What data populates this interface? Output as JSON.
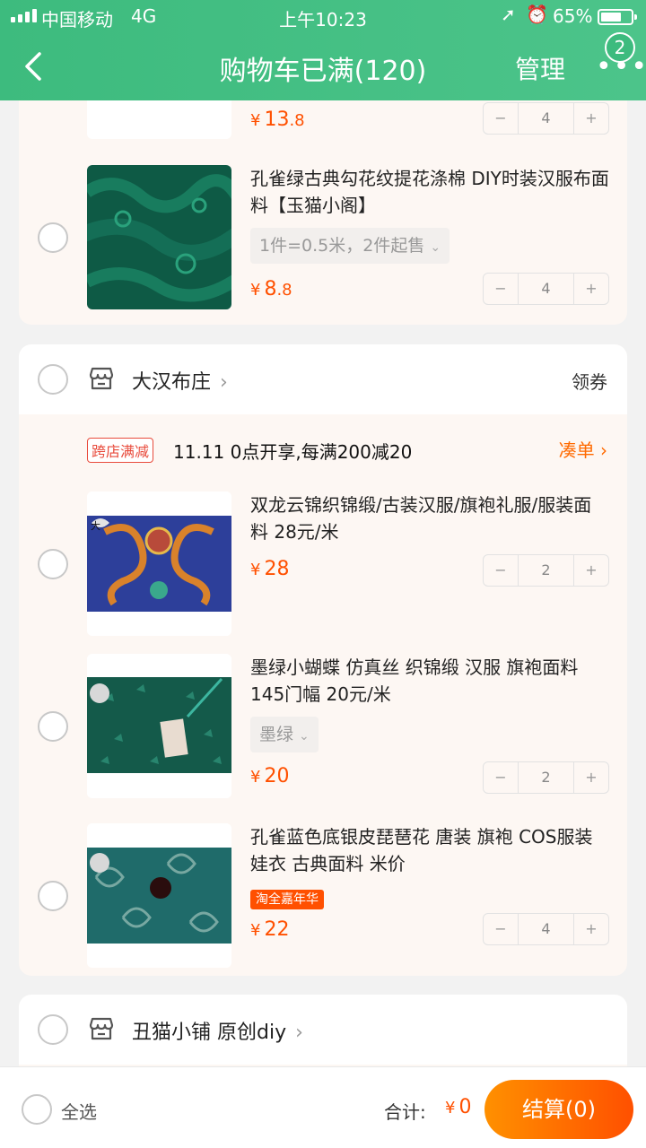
{
  "status_bar": {
    "carrier": "中国移动",
    "network": "4G",
    "time": "上午10:23",
    "battery": "65%"
  },
  "nav": {
    "title": "购物车已满(120)",
    "manage_label": "管理",
    "more_badge": "2"
  },
  "shop_top": {
    "items": [
      {
        "price_int": "13",
        "price_dec": ".8",
        "quantity": "4"
      },
      {
        "title": "孔雀绿古典勾花纹提花涤棉  DIY时装汉服布面料【玉猫小阁】",
        "sku": "1件=0.5米，2件起售",
        "price_int": "8",
        "price_dec": ".8",
        "quantity": "4"
      }
    ]
  },
  "shop_dahan": {
    "name": "大汉布庄",
    "coupon_label": "领券",
    "promo": {
      "tag": "跨店满减",
      "text": "11.11 0点开享,每满200减20",
      "link": "凑单"
    },
    "items": [
      {
        "title": "双龙云锦织锦缎/古装汉服/旗袍礼服/服装面料 28元/米",
        "price_int": "28",
        "quantity": "2"
      },
      {
        "title": "墨绿小蝴蝶 仿真丝 织锦缎 汉服 旗袍面料 145门幅 20元/米",
        "sku": "墨绿",
        "price_int": "20",
        "quantity": "2"
      },
      {
        "title": "孔雀蓝色底银皮琵琶花  唐装 旗袍 COS服装 娃衣 古典面料 米价",
        "badge": "淘全嘉年华",
        "price_int": "22",
        "quantity": "4"
      }
    ]
  },
  "shop_chou": {
    "name": "丑猫小铺 原创diy"
  },
  "bottom_bar": {
    "select_all": "全选",
    "total_label": "合计:",
    "total_value": "0",
    "checkout": "结算(0)"
  },
  "common": {
    "currency": "¥",
    "minus": "−",
    "plus": "+",
    "arrow": "›",
    "chevron": "⌄"
  },
  "colors": {
    "brand_green": "#3dbb7e",
    "price_orange": "#ff5000",
    "checkout_gradient_start": "#ff9000"
  }
}
